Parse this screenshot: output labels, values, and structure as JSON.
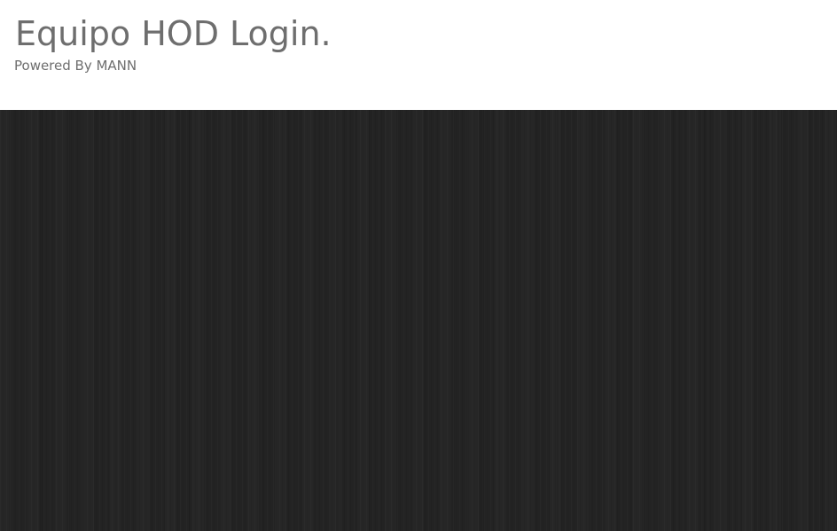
{
  "header": {
    "title": "Equipo HOD Login.",
    "subtitle": "Powered By MANN"
  },
  "colors": {
    "header_background": "#ffffff",
    "text": "#6e6e6e",
    "panel_background": "#232323"
  }
}
